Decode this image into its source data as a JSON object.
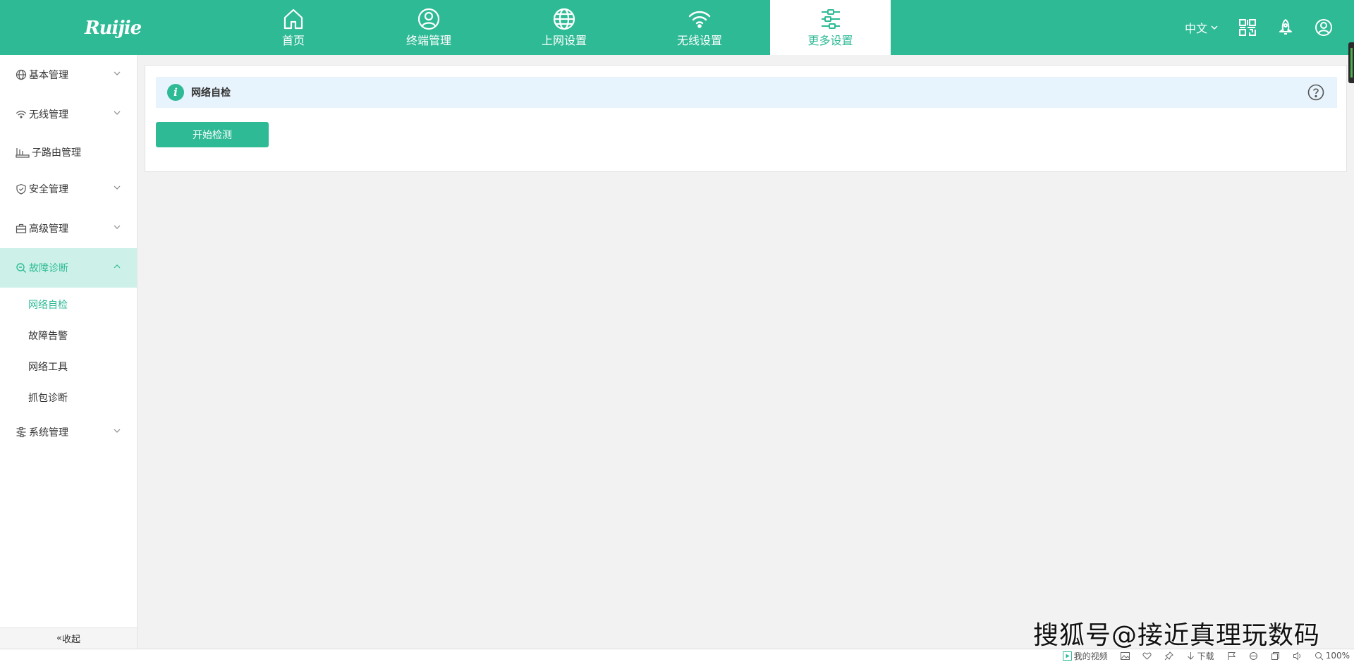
{
  "brand": {
    "logo_text": "Ruijie"
  },
  "nav": {
    "items": [
      {
        "label": "首页",
        "icon": "home-icon"
      },
      {
        "label": "终端管理",
        "icon": "user-circle-icon"
      },
      {
        "label": "上网设置",
        "icon": "globe-icon"
      },
      {
        "label": "无线设置",
        "icon": "wifi-icon"
      },
      {
        "label": "更多设置",
        "icon": "sliders-icon",
        "active": true
      }
    ]
  },
  "top_right": {
    "language": "中文",
    "icons": [
      "qr-code-icon",
      "rocket-icon",
      "account-icon"
    ]
  },
  "sidebar": {
    "groups": [
      {
        "label": "基本管理",
        "icon": "globe-icon"
      },
      {
        "label": "无线管理",
        "icon": "wifi-icon"
      },
      {
        "label": "子路由管理",
        "icon": "router-icon"
      },
      {
        "label": "安全管理",
        "icon": "shield-icon"
      },
      {
        "label": "高级管理",
        "icon": "toolbox-icon"
      },
      {
        "label": "故障诊断",
        "icon": "search-icon",
        "active": true
      },
      {
        "label": "系统管理",
        "icon": "sliders-icon"
      }
    ],
    "sub_items": [
      {
        "label": "网络自检",
        "active": true
      },
      {
        "label": "故障告警"
      },
      {
        "label": "网络工具"
      },
      {
        "label": "抓包诊断"
      }
    ],
    "collapse_label": "收起"
  },
  "main": {
    "info_title": "网络自检",
    "start_button": "开始检测"
  },
  "watermark": "搜狐号@接近真理玩数码",
  "statusbar": {
    "my_video": "我的视频",
    "download": "下载",
    "zoom": "100%"
  },
  "colors": {
    "accent": "#2fba96",
    "accent_light": "#cdf1e8",
    "info_bg": "#e8f4fd"
  }
}
